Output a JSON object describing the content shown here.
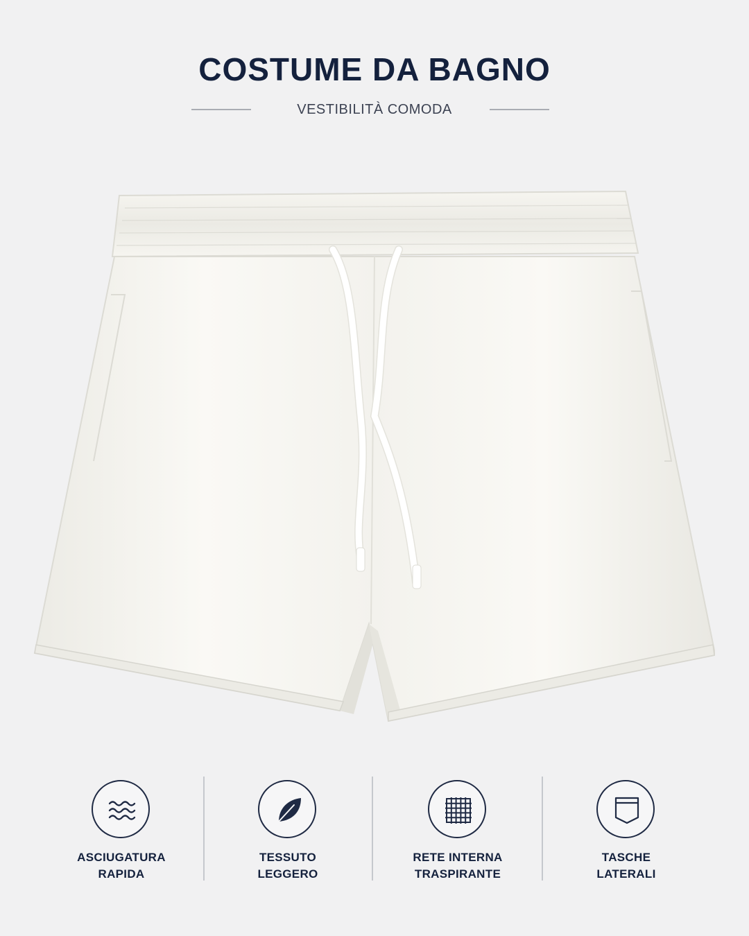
{
  "header": {
    "title": "COSTUME DA BAGNO",
    "subtitle": "VESTIBILITÀ COMODA"
  },
  "product": {
    "name": "swim-shorts",
    "color": "#f7f6f2"
  },
  "features": [
    {
      "icon": "waves-icon",
      "line1": "ASCIUGATURA",
      "line2": "RAPIDA"
    },
    {
      "icon": "leaf-icon",
      "line1": "TESSUTO",
      "line2": "LEGGERO"
    },
    {
      "icon": "mesh-grid-icon",
      "line1": "RETE INTERNA",
      "line2": "TRASPIRANTE"
    },
    {
      "icon": "pocket-icon",
      "line1": "TASCHE",
      "line2": "LATERALI"
    }
  ],
  "colors": {
    "background": "#f1f1f2",
    "navy": "#14213d",
    "divider": "#c5c8cd"
  }
}
